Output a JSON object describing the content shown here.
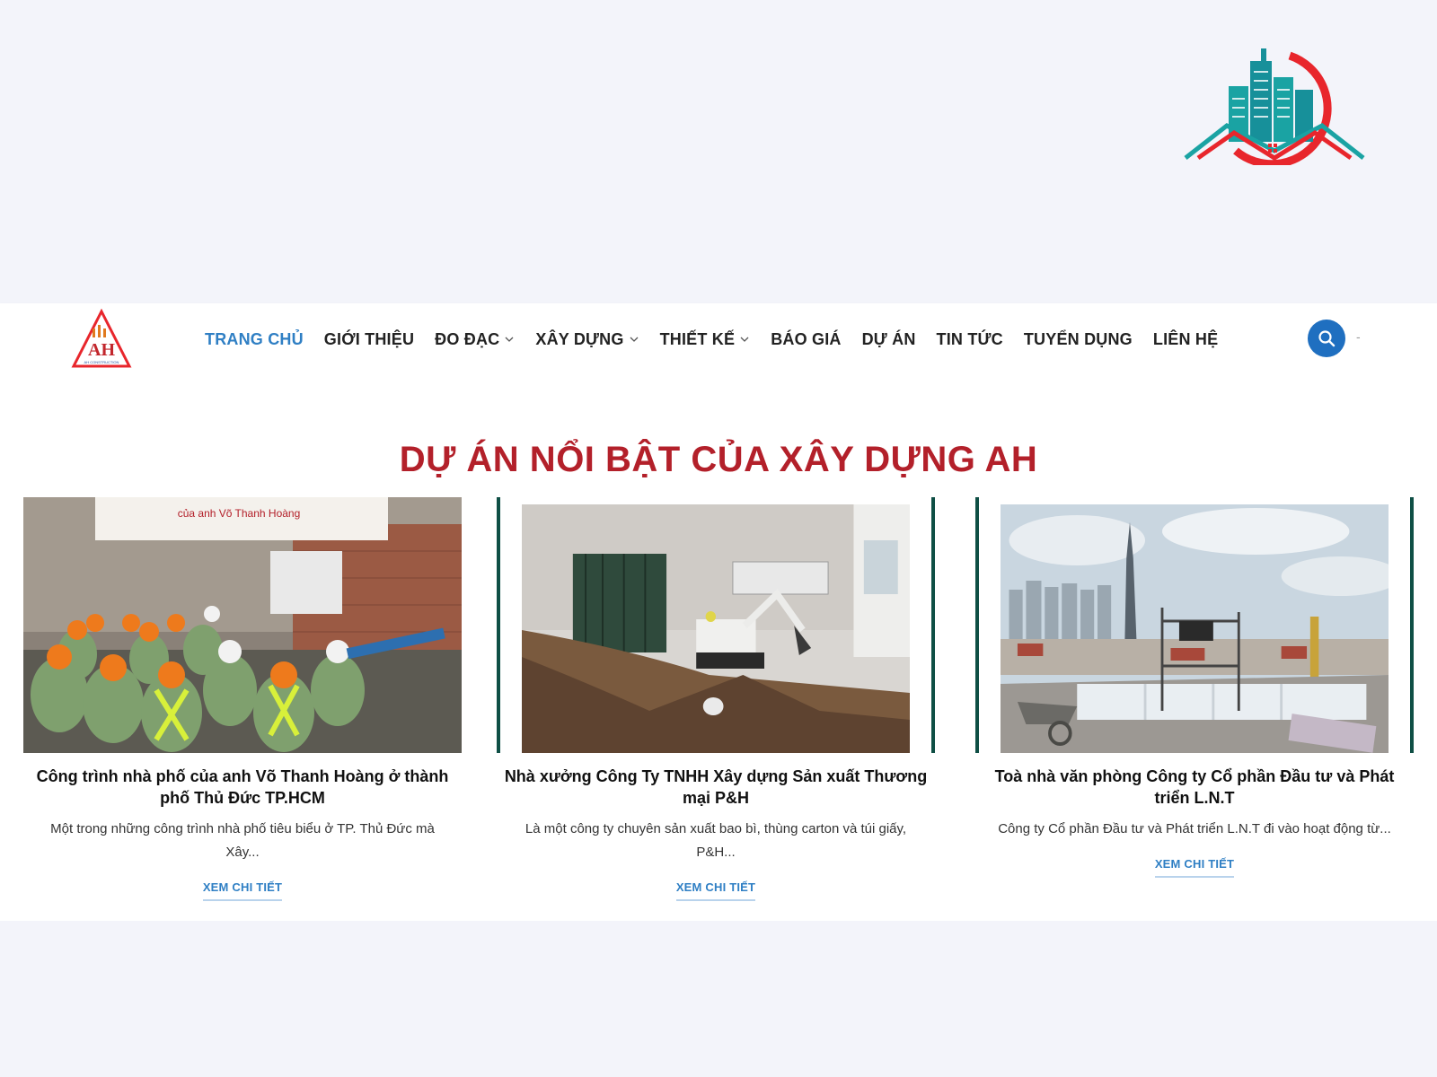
{
  "brand": {
    "logo_icon": "building-skyline-logo",
    "accent": "#e8262c",
    "teal": "#1aa3a3"
  },
  "nav": {
    "logo_icon": "ah-construction-logo",
    "logo_text": "AH CONSTRUCTION",
    "items": [
      {
        "label": "TRANG CHỦ",
        "active": true,
        "dropdown": false
      },
      {
        "label": "GIỚI THIỆU",
        "active": false,
        "dropdown": false
      },
      {
        "label": "ĐO ĐẠC",
        "active": false,
        "dropdown": true
      },
      {
        "label": "XÂY DỰNG",
        "active": false,
        "dropdown": true
      },
      {
        "label": "THIẾT KẾ",
        "active": false,
        "dropdown": true
      },
      {
        "label": "BÁO GIÁ",
        "active": false,
        "dropdown": false
      },
      {
        "label": "DỰ ÁN",
        "active": false,
        "dropdown": false
      },
      {
        "label": "TIN TỨC",
        "active": false,
        "dropdown": false
      },
      {
        "label": "TUYỂN DỤNG",
        "active": false,
        "dropdown": false
      },
      {
        "label": "LIÊN HỆ",
        "active": false,
        "dropdown": false
      }
    ],
    "search_icon": "search-icon",
    "trailing": "-",
    "active_color": "#2f7fc4"
  },
  "section": {
    "title": "DỰ ÁN NỔI BẬT CỦA XÂY DỰNG AH",
    "title_color": "#b3202a"
  },
  "projects": [
    {
      "image_caption": "của anh Võ Thanh Hoàng",
      "title": "Công trình nhà phố của anh Võ Thanh Hoàng ở thành phố Thủ Đức TP.HCM",
      "desc": "Một trong những công trình nhà phố tiêu biểu ở TP. Thủ Đức mà Xây...",
      "link": "XEM CHI TIẾT"
    },
    {
      "title": "Nhà xưởng Công Ty TNHH Xây dựng Sản xuất Thương mại P&H",
      "desc": "Là một công ty chuyên sản xuất bao bì, thùng carton và túi giấy, P&H...",
      "link": "XEM CHI TIẾT"
    },
    {
      "title": "Toà nhà văn phòng Công ty Cổ phần Đầu tư và Phát triển L.N.T",
      "desc": "Công ty Cổ phần Đầu tư và Phát triển L.N.T đi vào hoạt động từ...",
      "link": "XEM CHI TIẾT"
    }
  ]
}
